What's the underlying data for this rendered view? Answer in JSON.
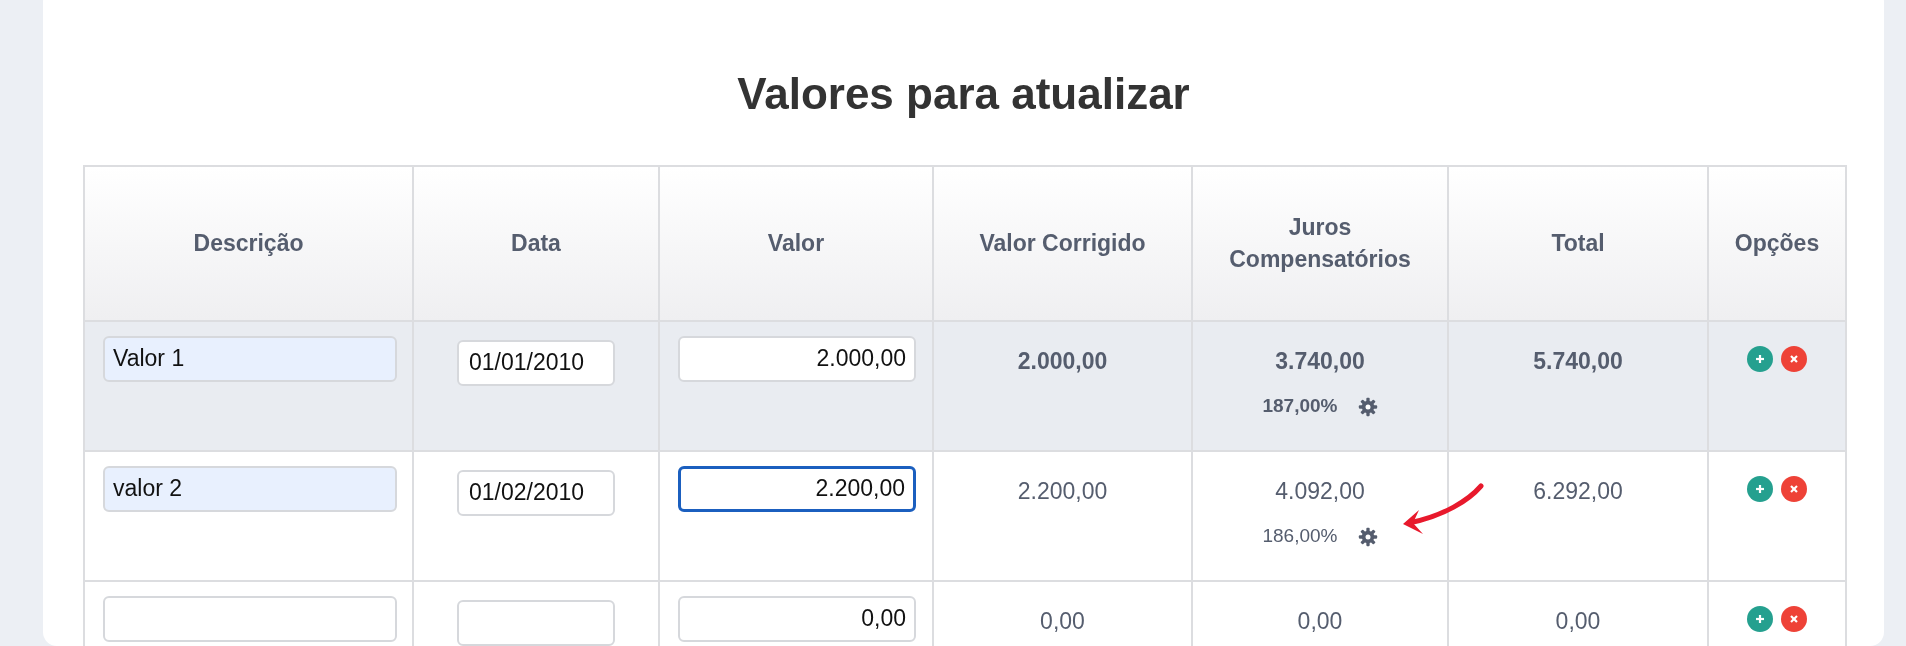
{
  "title": "Valores para atualizar",
  "table": {
    "columns": [
      "Descrição",
      "Data",
      "Valor",
      "Valor Corrigido",
      "Juros Compensatórios",
      "Total",
      "Opções"
    ],
    "rows": [
      {
        "selected": true,
        "descricao": {
          "value": "Valor 1",
          "autofilled": true
        },
        "data": {
          "value": "01/01/2010"
        },
        "valor": {
          "value": "2.000,00",
          "focused": false
        },
        "valor_corrigido": "2.000,00",
        "juros": "3.740,00",
        "juros_percent": "187,00%",
        "marked": false,
        "total": "5.740,00"
      },
      {
        "selected": false,
        "descricao": {
          "value": "valor 2",
          "autofilled": true
        },
        "data": {
          "value": "01/02/2010"
        },
        "valor": {
          "value": "2.200,00",
          "focused": true
        },
        "valor_corrigido": "2.200,00",
        "juros": "4.092,00",
        "juros_percent": "186,00%",
        "marked": true,
        "total": "6.292,00"
      },
      {
        "selected": false,
        "descricao": {
          "autofilled": false
        },
        "data": {},
        "valor": {
          "value": "0,00",
          "focused": false
        },
        "valor_corrigido": "0,00",
        "juros": "0,00",
        "marked": false,
        "total": "0,00"
      }
    ]
  }
}
